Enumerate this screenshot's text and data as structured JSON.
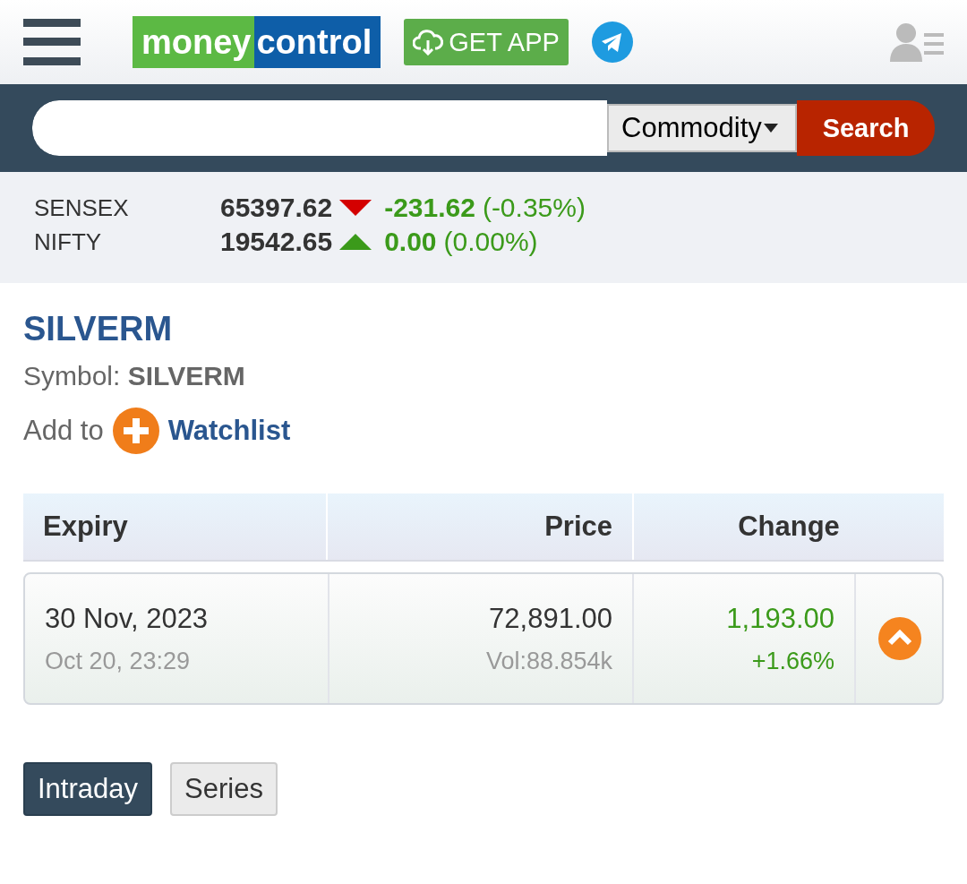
{
  "header": {
    "logo": {
      "part_1": "money",
      "part_2": "control"
    },
    "get_app": "GET APP"
  },
  "search": {
    "category": "Commodity",
    "button": "Search"
  },
  "indices": [
    {
      "name": "SENSEX",
      "value": "65397.62",
      "falling": true,
      "change": "-231.62",
      "percent": "(-0.35%)"
    },
    {
      "name": "NIFTY",
      "value": "19542.65",
      "falling": false,
      "change": "0.00",
      "percent": "(0.00%)"
    }
  ],
  "title": "SILVERM",
  "symbol": {
    "label": "Symbol:",
    "value": "SILVERM"
  },
  "watchlist": {
    "label": "Add to",
    "link": "Watchlist"
  },
  "table": {
    "columns": [
      "Expiry",
      "Price",
      "Change"
    ],
    "rows": [
      {
        "expiry": "30 Nov, 2023",
        "time": "Oct 20, 23:29",
        "price": "72,891.00",
        "volume": "Vol:88.854k",
        "change": "1,193.00",
        "percent": "+1.66%",
        "expanded": false
      }
    ]
  },
  "tabs": [
    {
      "label": "Intraday",
      "selected": true
    },
    {
      "label": "Series",
      "selected": false
    }
  ]
}
